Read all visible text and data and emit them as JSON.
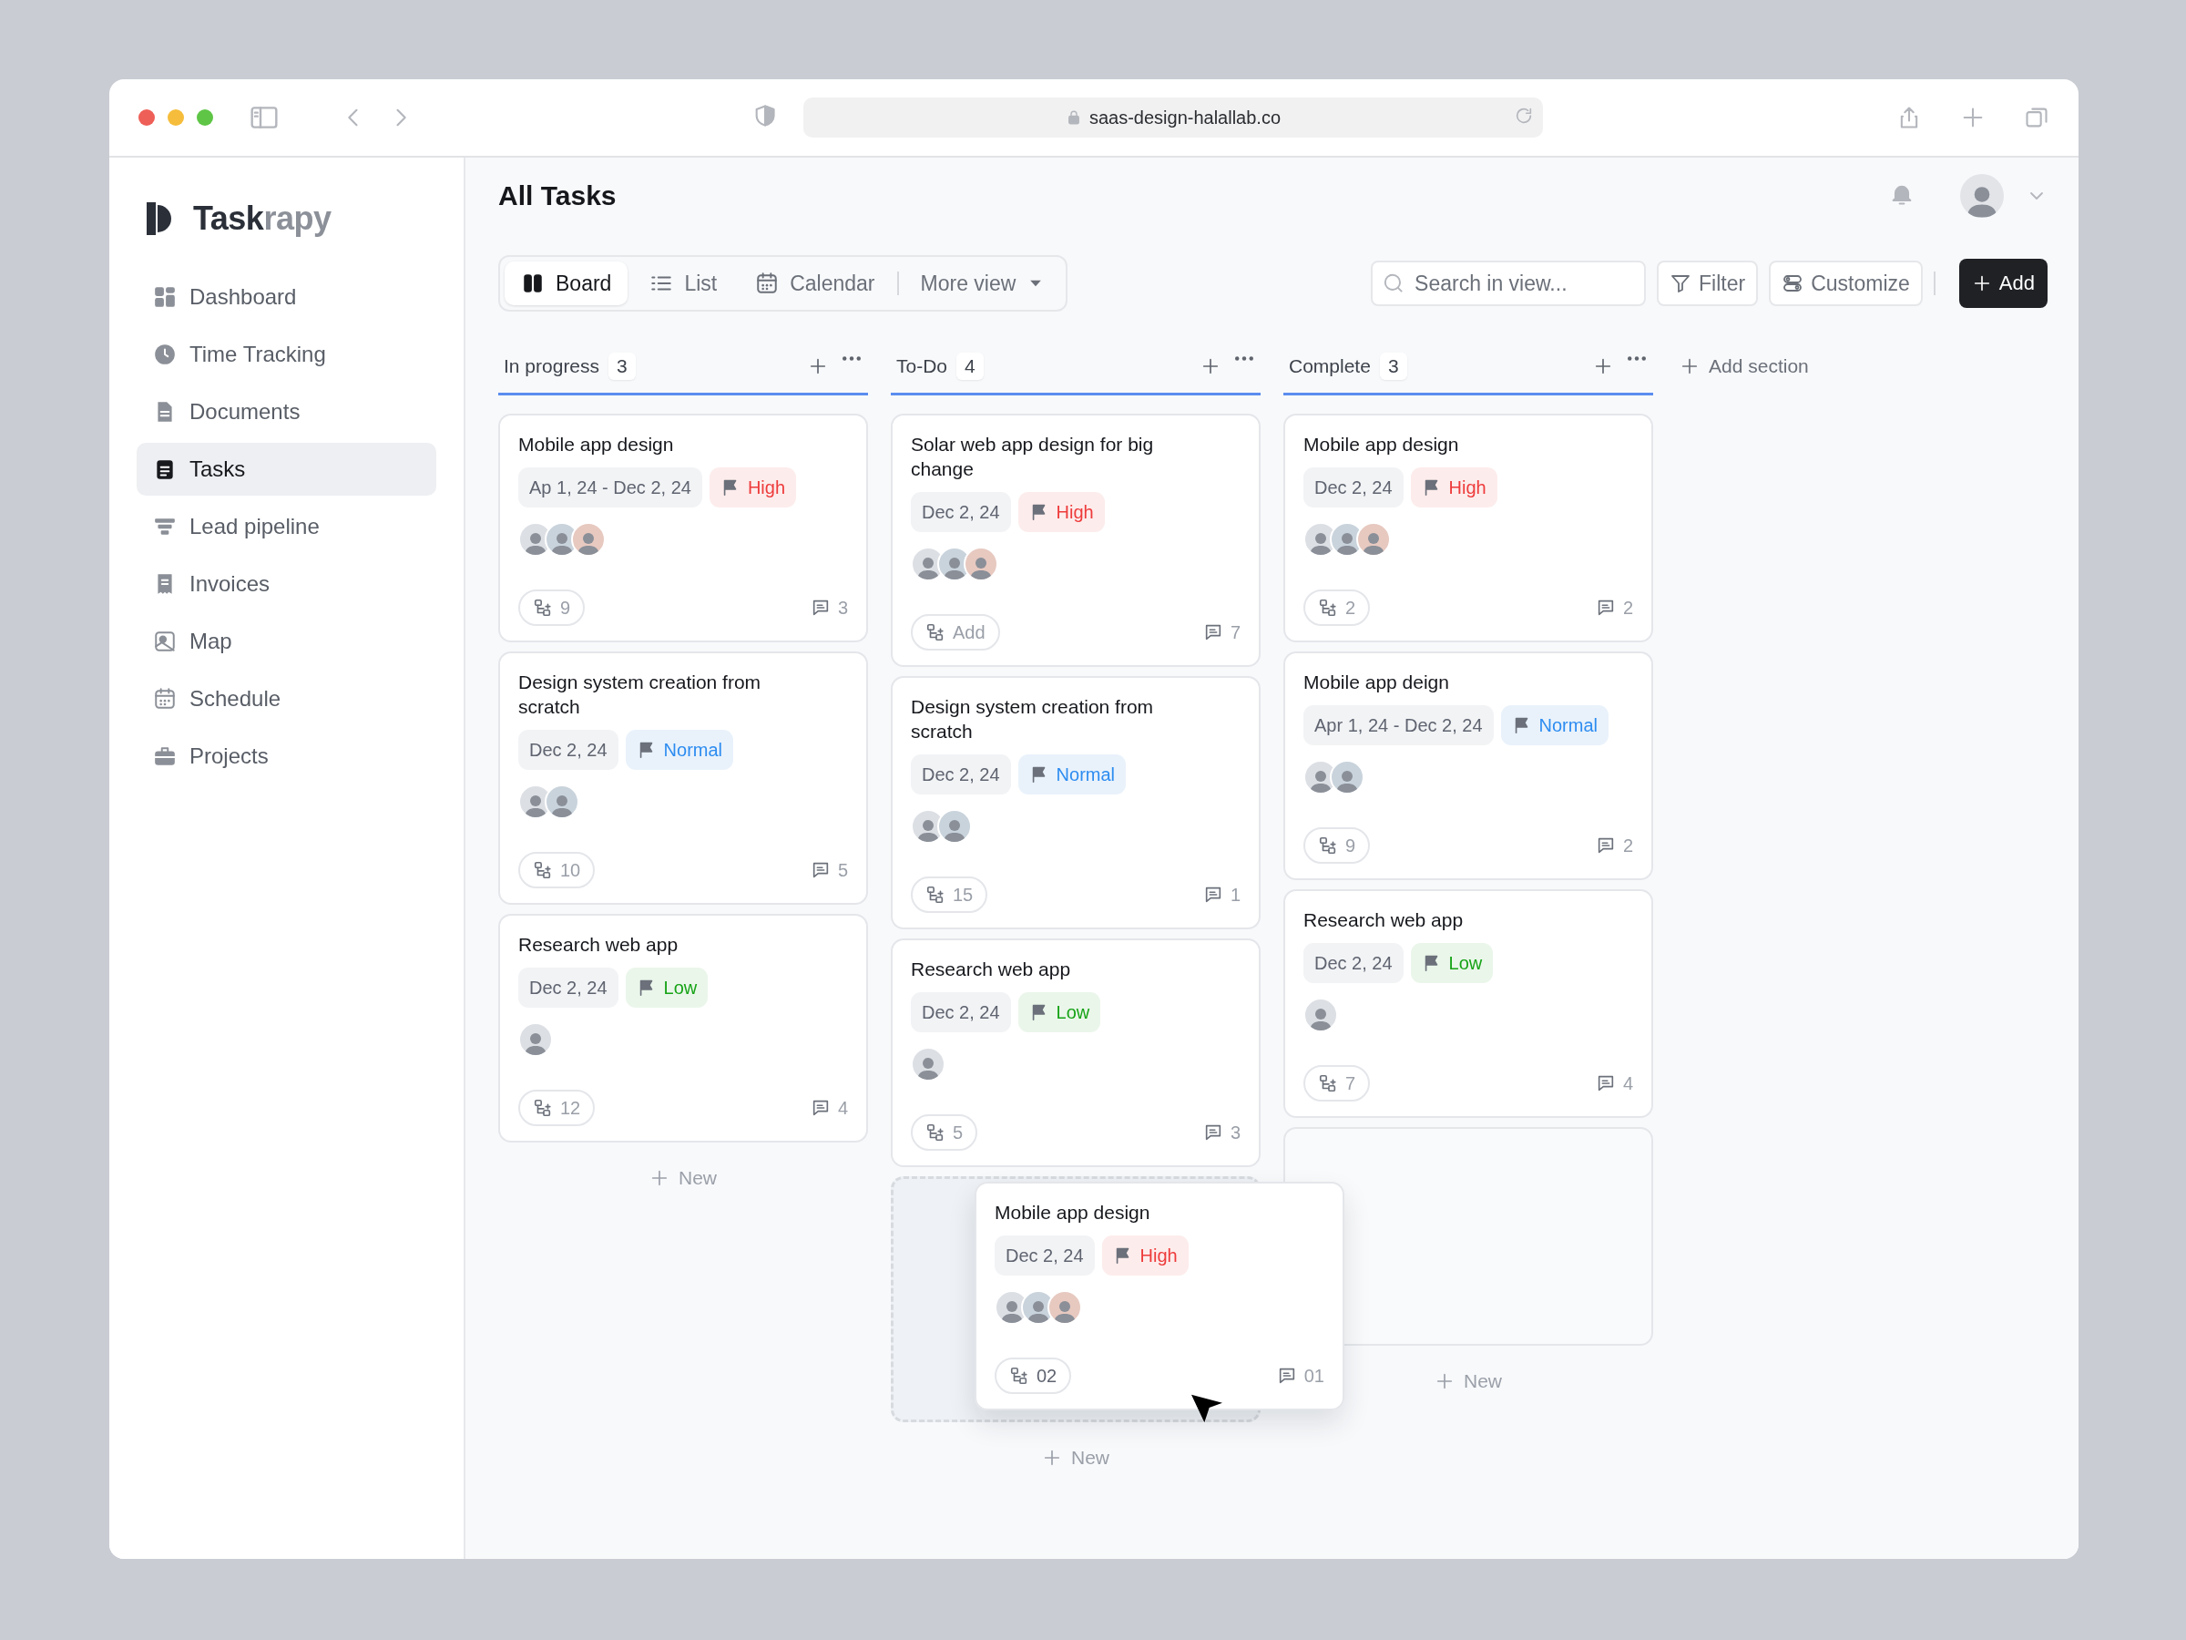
{
  "browser": {
    "url": "saas-design-halallab.co"
  },
  "sidebar": {
    "logo": {
      "strong": "Task",
      "light": "rapy"
    },
    "items": [
      {
        "label": "Dashboard",
        "selected": false
      },
      {
        "label": "Time Tracking",
        "selected": false
      },
      {
        "label": "Documents",
        "selected": false
      },
      {
        "label": "Tasks",
        "selected": true
      },
      {
        "label": "Lead pipeline",
        "selected": false
      },
      {
        "label": "Invoices",
        "selected": false
      },
      {
        "label": "Map",
        "selected": false
      },
      {
        "label": "Schedule",
        "selected": false
      },
      {
        "label": "Projects",
        "selected": false
      }
    ]
  },
  "page": {
    "title": "All Tasks"
  },
  "views": [
    {
      "label": "Board",
      "selected": true
    },
    {
      "label": "List",
      "selected": false
    },
    {
      "label": "Calendar",
      "selected": false
    }
  ],
  "more_view": "More view",
  "search": {
    "placeholder": "Search in view..."
  },
  "actions": {
    "filter": "Filter",
    "customize": "Customize",
    "add": "Add"
  },
  "add_section": "Add section",
  "columns": [
    {
      "title": "In progress",
      "count": "3",
      "new_label": "New",
      "cards": [
        {
          "title": "Mobile app design",
          "date": "Ap 1, 24 - Dec 2, 24",
          "priority": {
            "label": "High",
            "kind": "high"
          },
          "avatars": [
            {
              "kind": "person"
            },
            {
              "kind": "person"
            },
            {
              "kind": "person"
            }
          ],
          "subtasks": "9",
          "comments": "3"
        },
        {
          "title": "Design system creation from scratch",
          "date": "Dec 2, 24",
          "priority": {
            "label": "Normal",
            "kind": "normal"
          },
          "avatars": [
            {
              "kind": "person"
            },
            {
              "kind": "person"
            }
          ],
          "subtasks": "10",
          "comments": "5"
        },
        {
          "title": "Research web app",
          "date": "Dec 2, 24",
          "priority": {
            "label": "Low",
            "kind": "low"
          },
          "avatars": [
            {
              "kind": "person"
            }
          ],
          "subtasks": "12",
          "comments": "4"
        }
      ]
    },
    {
      "title": "To-Do",
      "count": "4",
      "drop_placeholder": true,
      "new_label": "New",
      "cards": [
        {
          "title": "Solar web app design for big change",
          "date": "Dec 2, 24",
          "priority": {
            "label": "High",
            "kind": "high"
          },
          "avatars": [
            {
              "kind": "person"
            },
            {
              "kind": "person"
            },
            {
              "kind": "person"
            }
          ],
          "subtasks": "Add",
          "comments": "7"
        },
        {
          "title": "Design system creation from scratch",
          "date": "Dec 2, 24",
          "priority": {
            "label": "Normal",
            "kind": "normal"
          },
          "avatars": [
            {
              "kind": "person"
            },
            {
              "kind": "person"
            }
          ],
          "subtasks": "15",
          "comments": "1"
        },
        {
          "title": "Research web app",
          "date": "Dec 2, 24",
          "priority": {
            "label": "Low",
            "kind": "low"
          },
          "avatars": [
            {
              "kind": "person"
            }
          ],
          "subtasks": "5",
          "comments": "3"
        }
      ],
      "dragged_card": {
        "title": "Mobile app design",
        "date": "Dec 2, 24",
        "priority": {
          "label": "High",
          "kind": "high"
        },
        "avatars": [
          {
            "kind": "person"
          },
          {
            "kind": "person"
          },
          {
            "kind": "person"
          }
        ],
        "subtasks": "02",
        "comments": "01"
      }
    },
    {
      "title": "Complete",
      "count": "3",
      "empty_slot": true,
      "new_label": "New",
      "cards": [
        {
          "title": "Mobile app design",
          "date": "Dec 2, 24",
          "priority": {
            "label": "High",
            "kind": "high"
          },
          "avatars": [
            {
              "kind": "person"
            },
            {
              "kind": "person"
            },
            {
              "kind": "person"
            }
          ],
          "subtasks": "2",
          "comments": "2"
        },
        {
          "title": "Mobile app deign",
          "date": "Apr 1, 24 - Dec 2, 24",
          "priority": {
            "label": "Normal",
            "kind": "normal"
          },
          "avatars": [
            {
              "kind": "person"
            },
            {
              "kind": "person"
            }
          ],
          "subtasks": "9",
          "comments": "2"
        },
        {
          "title": "Research web app",
          "date": "Dec 2, 24",
          "priority": {
            "label": "Low",
            "kind": "low"
          },
          "avatars": [
            {
              "kind": "person"
            }
          ],
          "subtasks": "7",
          "comments": "4"
        }
      ]
    }
  ]
}
